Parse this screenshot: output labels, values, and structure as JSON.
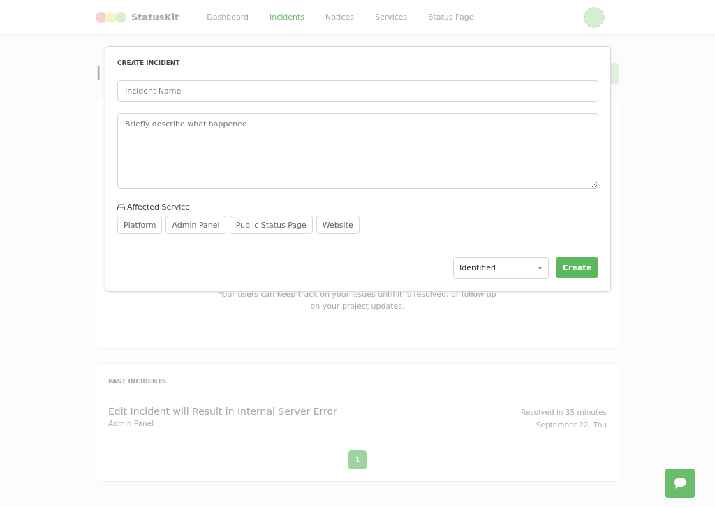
{
  "header": {
    "brand": "StatusKit",
    "nav": [
      {
        "label": "Dashboard",
        "selected": false
      },
      {
        "label": "Incidents",
        "selected": true
      },
      {
        "label": "Notices",
        "selected": false
      },
      {
        "label": "Services",
        "selected": false
      },
      {
        "label": "Status Page",
        "selected": false
      }
    ]
  },
  "page": {
    "title_fragment": "I",
    "empty_text": [
      "Your users can keep track on your issues until it is resolved, or follow up",
      "on your project updates."
    ]
  },
  "past_incidents": {
    "heading": "PAST INCIDENTS",
    "items": [
      {
        "title": "Edit Incident will Result in Internal Server Error",
        "service": "Admin Panel",
        "duration": "Resolved in 35 minutes",
        "date": "September 22, Thu"
      }
    ],
    "pages": [
      {
        "label": "1",
        "selected": true
      }
    ]
  },
  "modal": {
    "title": "CREATE INCIDENT",
    "name_placeholder": "Incident Name",
    "description_placeholder": "Briefly describe what happened",
    "services_label": "Affected Service",
    "services": [
      {
        "label": "Platform",
        "selected": false
      },
      {
        "label": "Admin Panel",
        "selected": false
      },
      {
        "label": "Public Status Page",
        "selected": false
      },
      {
        "label": "Website",
        "selected": false
      }
    ],
    "status": "Identified",
    "submit": "Create"
  }
}
